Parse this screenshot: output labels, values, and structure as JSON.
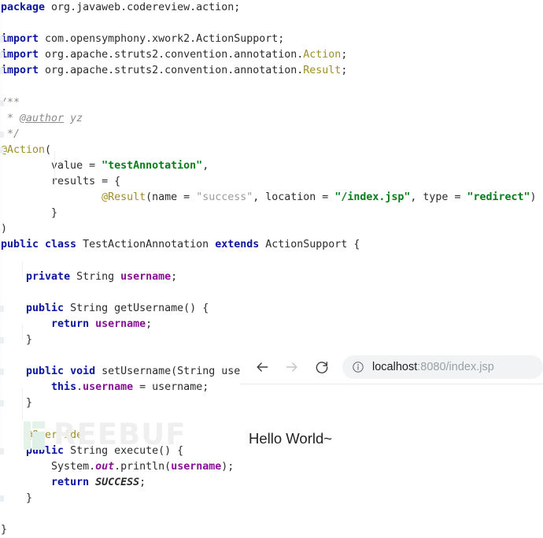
{
  "editor": {
    "language": "java",
    "colors": {
      "keyword": "#0a15a0",
      "annotation": "#9e8f25",
      "string": "#067d17",
      "string_muted": "#9b9b9b",
      "field": "#871094",
      "comment": "#8c8c8c",
      "text": "#2b2b2b",
      "background": "#ffffff"
    },
    "lines": [
      {
        "id": 1,
        "tokens": [
          {
            "t": "package ",
            "c": "kw"
          },
          {
            "t": "org.javaweb.codereview.action;",
            "c": "plain"
          }
        ]
      },
      {
        "id": 2,
        "tokens": []
      },
      {
        "id": 3,
        "gutter": true,
        "tokens": [
          {
            "t": "import ",
            "c": "kw"
          },
          {
            "t": "com.opensymphony.xwork2.ActionSupport;",
            "c": "plain"
          }
        ]
      },
      {
        "id": 4,
        "gutter": true,
        "tokens": [
          {
            "t": "import ",
            "c": "kw"
          },
          {
            "t": "org.apache.struts2.convention.annotation.",
            "c": "plain"
          },
          {
            "t": "Action",
            "c": "anno"
          },
          {
            "t": ";",
            "c": "plain"
          }
        ]
      },
      {
        "id": 5,
        "gutter": true,
        "tokens": [
          {
            "t": "import ",
            "c": "kw"
          },
          {
            "t": "org.apache.struts2.convention.annotation.",
            "c": "plain"
          },
          {
            "t": "Result",
            "c": "anno"
          },
          {
            "t": ";",
            "c": "plain"
          }
        ]
      },
      {
        "id": 6,
        "tokens": []
      },
      {
        "id": 7,
        "gutter": true,
        "tokens": [
          {
            "t": "/**",
            "c": "cmt"
          }
        ]
      },
      {
        "id": 8,
        "tokens": [
          {
            "t": " * ",
            "c": "cmt"
          },
          {
            "t": "@author",
            "c": "cmttag"
          },
          {
            "t": " yz",
            "c": "cmt"
          }
        ]
      },
      {
        "id": 9,
        "gutter": true,
        "tokens": [
          {
            "t": " */",
            "c": "cmt"
          }
        ]
      },
      {
        "id": 10,
        "gutter": true,
        "tokens": [
          {
            "t": "@Action",
            "c": "anno"
          },
          {
            "t": "(",
            "c": "plain"
          }
        ]
      },
      {
        "id": 11,
        "tokens": [
          {
            "t": "        value = ",
            "c": "plain"
          },
          {
            "t": "\"testAnnotation\"",
            "c": "str"
          },
          {
            "t": ",",
            "c": "plain"
          }
        ]
      },
      {
        "id": 12,
        "tokens": [
          {
            "t": "        results = {",
            "c": "plain"
          }
        ]
      },
      {
        "id": 13,
        "tokens": [
          {
            "t": "                ",
            "c": "plain"
          },
          {
            "t": "@Result",
            "c": "anno"
          },
          {
            "t": "(name = ",
            "c": "plain"
          },
          {
            "t": "\"success\"",
            "c": "strgray"
          },
          {
            "t": ", location = ",
            "c": "plain"
          },
          {
            "t": "\"/index.jsp\"",
            "c": "str"
          },
          {
            "t": ", type = ",
            "c": "plain"
          },
          {
            "t": "\"redirect\"",
            "c": "str"
          },
          {
            "t": ")",
            "c": "plain"
          }
        ]
      },
      {
        "id": 14,
        "tokens": [
          {
            "t": "        }",
            "c": "plain"
          }
        ]
      },
      {
        "id": 15,
        "tokens": [
          {
            "t": ")",
            "c": "plain"
          }
        ]
      },
      {
        "id": 16,
        "tokens": [
          {
            "t": "public class ",
            "c": "kw"
          },
          {
            "t": "TestActionAnnotation ",
            "c": "plain"
          },
          {
            "t": "extends ",
            "c": "kw"
          },
          {
            "t": "ActionSupport {",
            "c": "plain"
          }
        ]
      },
      {
        "id": 17,
        "tokens": []
      },
      {
        "id": 18,
        "tokens": [
          {
            "t": "    ",
            "c": "plain"
          },
          {
            "t": "private ",
            "c": "kw"
          },
          {
            "t": "String ",
            "c": "plain"
          },
          {
            "t": "username",
            "c": "field"
          },
          {
            "t": ";",
            "c": "plain"
          }
        ]
      },
      {
        "id": 19,
        "tokens": []
      },
      {
        "id": 20,
        "gutter": true,
        "tokens": [
          {
            "t": "    ",
            "c": "plain"
          },
          {
            "t": "public ",
            "c": "kw"
          },
          {
            "t": "String getUsername() {",
            "c": "plain"
          }
        ]
      },
      {
        "id": 21,
        "tokens": [
          {
            "t": "        ",
            "c": "plain"
          },
          {
            "t": "return ",
            "c": "kw"
          },
          {
            "t": "username",
            "c": "field"
          },
          {
            "t": ";",
            "c": "plain"
          }
        ]
      },
      {
        "id": 22,
        "gutter": true,
        "tokens": [
          {
            "t": "    }",
            "c": "plain"
          }
        ]
      },
      {
        "id": 23,
        "tokens": []
      },
      {
        "id": 24,
        "gutter": true,
        "tokens": [
          {
            "t": "    ",
            "c": "plain"
          },
          {
            "t": "public void ",
            "c": "kw"
          },
          {
            "t": "setUsername(String username) {",
            "c": "plain"
          }
        ]
      },
      {
        "id": 25,
        "tokens": [
          {
            "t": "        ",
            "c": "plain"
          },
          {
            "t": "this",
            "c": "kw"
          },
          {
            "t": ".",
            "c": "plain"
          },
          {
            "t": "username",
            "c": "field"
          },
          {
            "t": " = username;",
            "c": "plain"
          }
        ]
      },
      {
        "id": 26,
        "gutter": true,
        "tokens": [
          {
            "t": "    }",
            "c": "plain"
          }
        ]
      },
      {
        "id": 27,
        "tokens": []
      },
      {
        "id": 28,
        "tokens": [
          {
            "t": "    ",
            "c": "plain"
          },
          {
            "t": "@Override",
            "c": "anno"
          }
        ]
      },
      {
        "id": 29,
        "gutter": true,
        "tokens": [
          {
            "t": "    ",
            "c": "plain"
          },
          {
            "t": "public ",
            "c": "kw"
          },
          {
            "t": "String execute() {",
            "c": "plain"
          }
        ]
      },
      {
        "id": 30,
        "tokens": [
          {
            "t": "        System.",
            "c": "plain"
          },
          {
            "t": "out",
            "c": "statfld"
          },
          {
            "t": ".println(",
            "c": "plain"
          },
          {
            "t": "username",
            "c": "field"
          },
          {
            "t": ");",
            "c": "plain"
          }
        ]
      },
      {
        "id": 31,
        "tokens": [
          {
            "t": "        ",
            "c": "plain"
          },
          {
            "t": "return ",
            "c": "kw"
          },
          {
            "t": "SUCCESS",
            "c": "constit"
          },
          {
            "t": ";",
            "c": "plain"
          }
        ]
      },
      {
        "id": 32,
        "gutter": true,
        "tokens": [
          {
            "t": "    }",
            "c": "plain"
          }
        ]
      },
      {
        "id": 33,
        "tokens": []
      },
      {
        "id": 34,
        "tokens": [
          {
            "t": "}",
            "c": "plain"
          }
        ]
      }
    ]
  },
  "browser": {
    "nav": {
      "back_icon": "arrow-left-icon",
      "forward_icon": "arrow-right-icon",
      "reload_icon": "reload-icon",
      "back_enabled": true,
      "forward_enabled": false
    },
    "omnibox": {
      "site_info_icon": "info-circle-icon",
      "host": "localhost",
      "path": ":8080/index.jsp",
      "full_url": "localhost:8080/index.jsp",
      "background": "#f1f3f4"
    },
    "page": {
      "body_text": "Hello World~"
    }
  },
  "watermark": {
    "logo_icon": "freebuf-logo-icon",
    "text": "REEBUF",
    "color": "#efefef",
    "mark_color": "#e4f2ea"
  }
}
